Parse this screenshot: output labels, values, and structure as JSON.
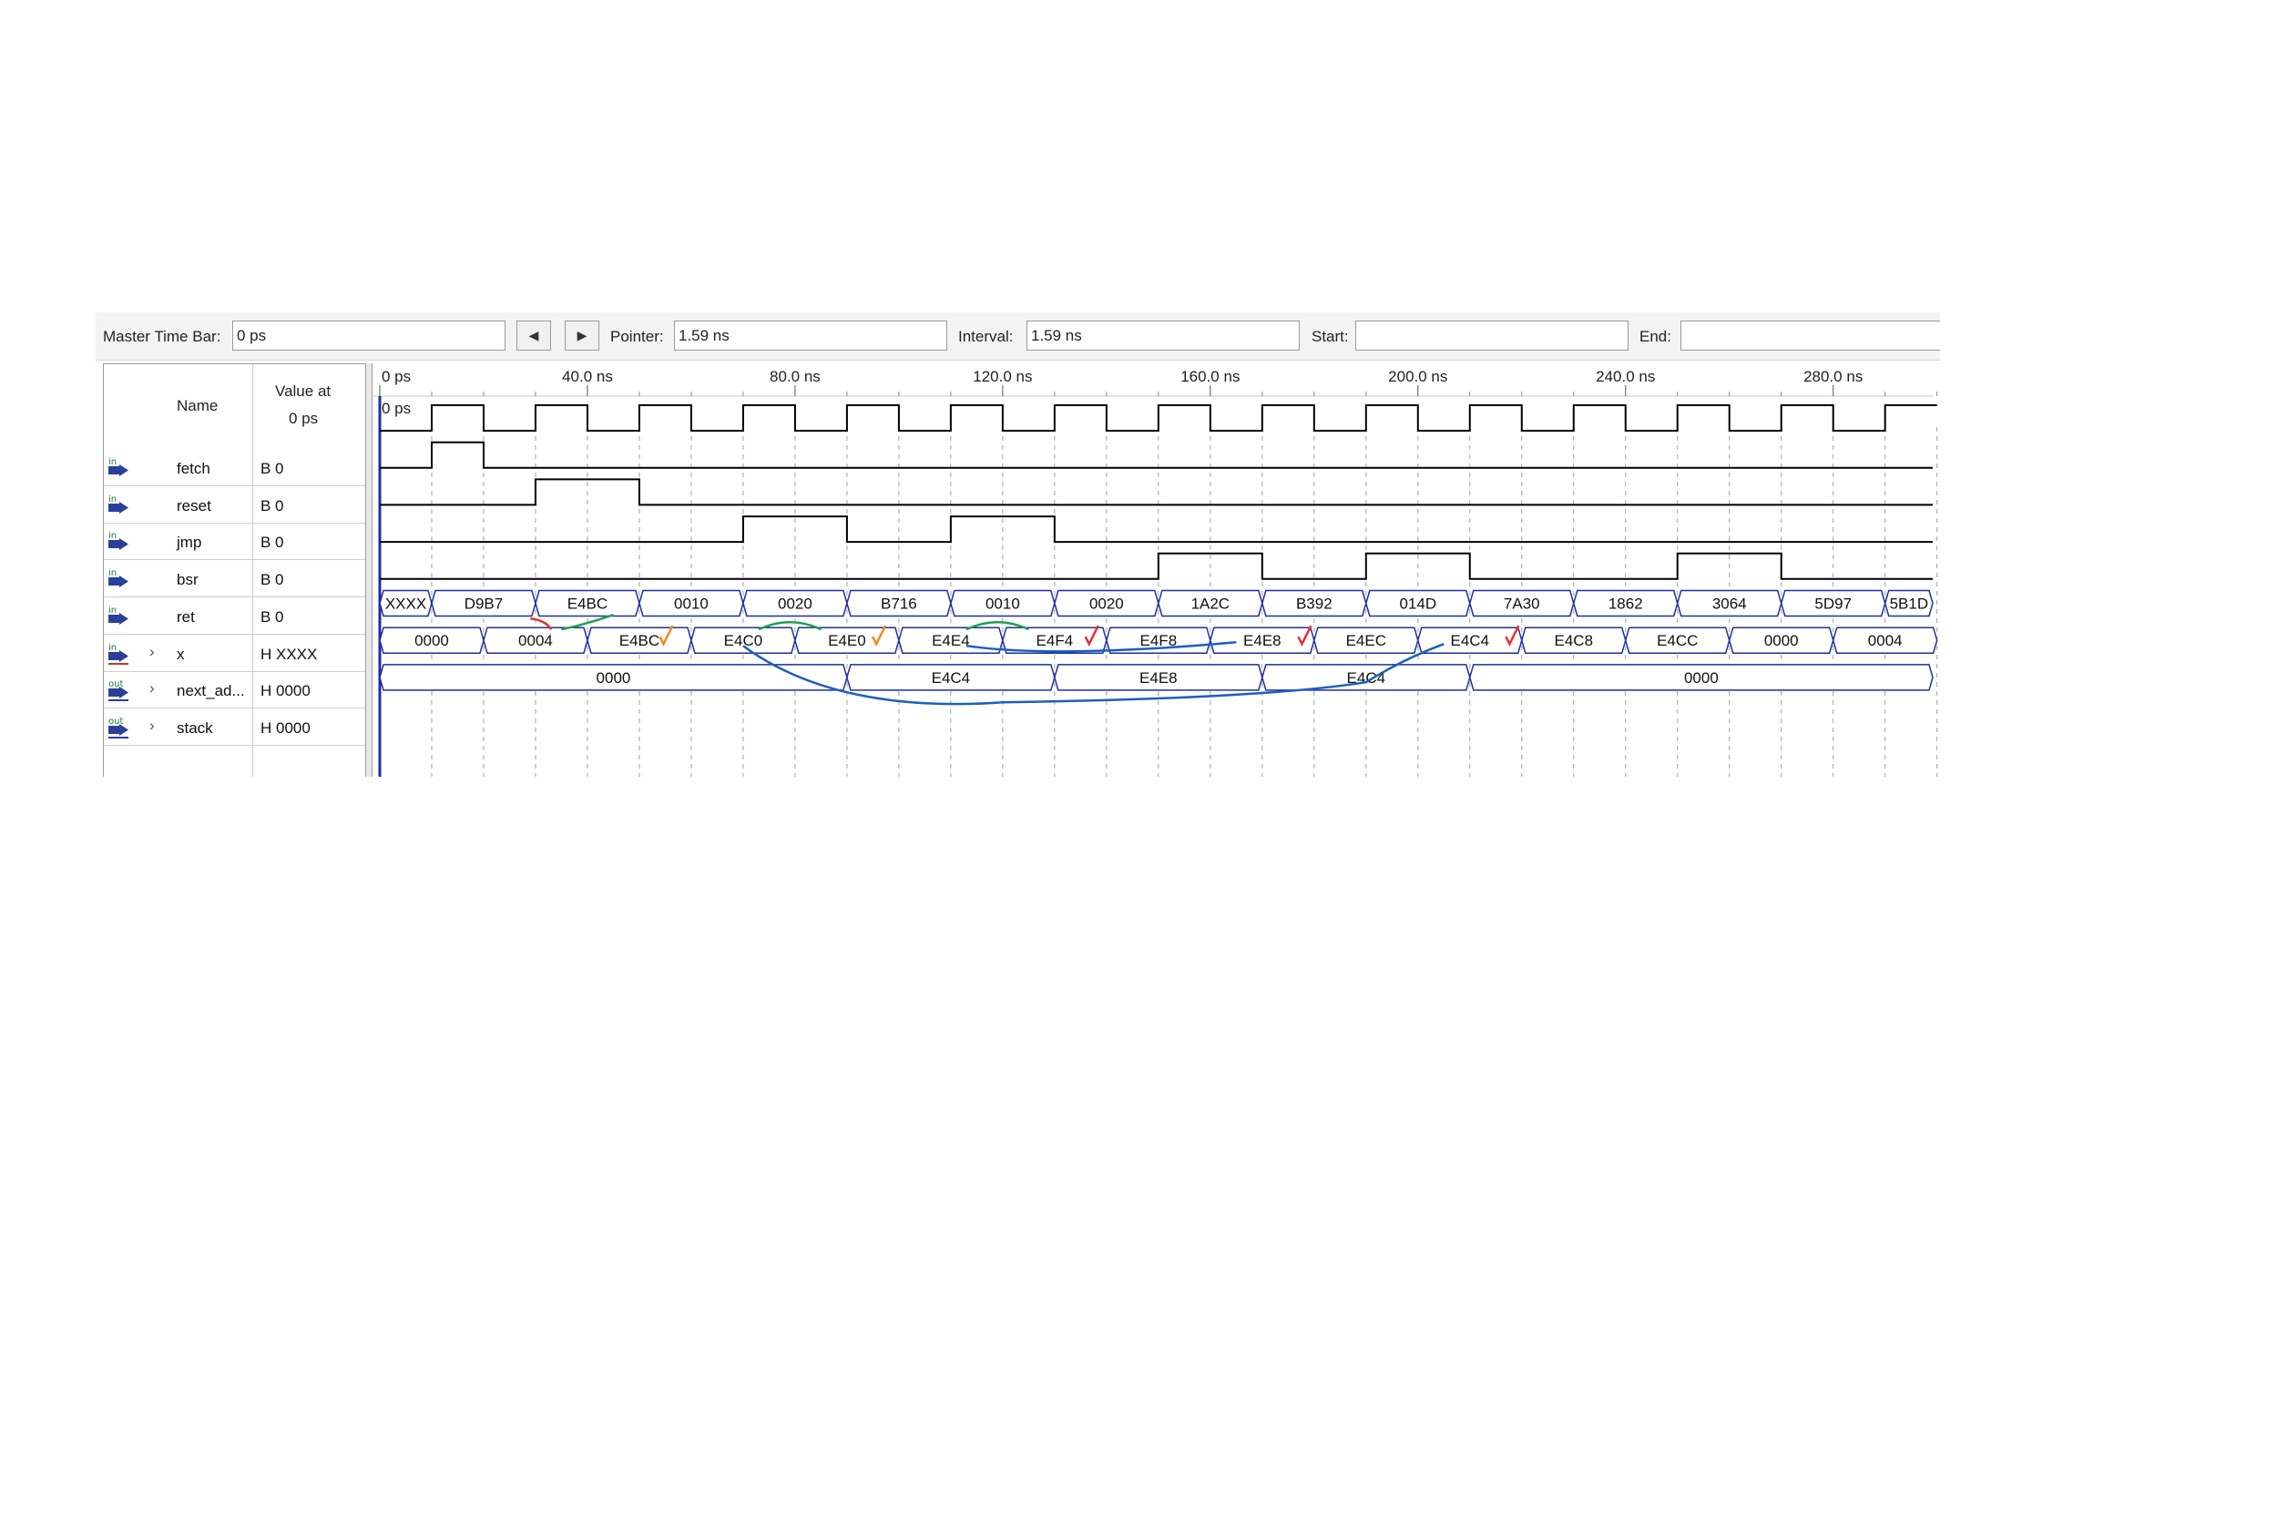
{
  "toolbar": {
    "master_time_bar_label": "Master Time Bar:",
    "master_time_bar_value": "0 ps",
    "pointer_label": "Pointer:",
    "pointer_value": "1.59 ns",
    "interval_label": "Interval:",
    "interval_value": "1.59 ns",
    "start_label": "Start:",
    "start_value": "",
    "end_label": "End:",
    "end_value": ""
  },
  "name_pane": {
    "name_header": "Name",
    "value_header_line1": "Value at",
    "value_header_line2": "0 ps"
  },
  "signals": [
    {
      "name": "fetch",
      "value": "B 0",
      "direction": "in",
      "type": "bit",
      "expandable": false
    },
    {
      "name": "reset",
      "value": "B 0",
      "direction": "in",
      "type": "bit",
      "expandable": false
    },
    {
      "name": "jmp",
      "value": "B 0",
      "direction": "in",
      "type": "bit",
      "expandable": false
    },
    {
      "name": "bsr",
      "value": "B 0",
      "direction": "in",
      "type": "bit",
      "expandable": false
    },
    {
      "name": "ret",
      "value": "B 0",
      "direction": "in",
      "type": "bit",
      "expandable": false
    },
    {
      "name": "x",
      "value": "H XXXX",
      "direction": "in",
      "type": "bus",
      "expandable": true
    },
    {
      "name": "next_ad...",
      "value": "H 0000",
      "direction": "out",
      "type": "bus",
      "expandable": true
    },
    {
      "name": "stack",
      "value": "H 0000",
      "direction": "out",
      "type": "bus",
      "expandable": true
    }
  ],
  "waveform": {
    "time_ticks": [
      "0 ps",
      "40.0 ns",
      "80.0 ns",
      "120.0 ns",
      "160.0 ns",
      "200.0 ns",
      "240.0 ns",
      "280.0 ns"
    ],
    "cursor_label": "0 ps",
    "time_unit_ns": 10,
    "time_range_ns": [
      0,
      300
    ],
    "fetch_period_ns": 20,
    "pulses_ns": {
      "reset": [
        [
          10,
          20
        ]
      ],
      "jmp": [
        [
          30,
          50
        ]
      ],
      "bsr": [
        [
          70,
          90
        ],
        [
          110,
          130
        ]
      ],
      "ret": [
        [
          150,
          170
        ],
        [
          190,
          210
        ],
        [
          250,
          270
        ]
      ]
    },
    "buses": {
      "x": {
        "starts_ns": [
          0,
          10,
          30,
          50,
          70,
          90,
          110,
          130,
          150,
          170,
          190,
          210,
          230,
          250,
          270,
          290
        ],
        "values": [
          "XXXX",
          "D9B7",
          "E4BC",
          "0010",
          "0020",
          "B716",
          "0010",
          "0020",
          "1A2C",
          "B392",
          "014D",
          "7A30",
          "1862",
          "3064",
          "5D97",
          "5B1D"
        ]
      },
      "next_ad": {
        "starts_ns": [
          0,
          20,
          40,
          60,
          80,
          100,
          120,
          140,
          160,
          180,
          200,
          220,
          240,
          260,
          280,
          300
        ],
        "values": [
          "0000",
          "0004",
          "E4BC",
          "E4C0",
          "E4E0",
          "E4E4",
          "E4F4",
          "E4F8",
          "E4E8",
          "E4EC",
          "E4C4",
          "E4C8",
          "E4CC",
          "0000",
          "0004"
        ]
      },
      "stack": {
        "starts_ns": [
          0,
          90,
          130,
          170,
          210
        ],
        "values": [
          "0000",
          "E4C4",
          "E4E8",
          "E4C4",
          "0000"
        ]
      }
    },
    "colors": {
      "grid_dash": "#a0a0a0",
      "bit_trace": "#000000",
      "bus_trace": "#1f2f9f",
      "cursor": "#1a2fa0",
      "annotation_red": "#e8312a",
      "annotation_orange": "#f08a1c",
      "annotation_green": "#20a050",
      "annotation_blue": "#1a5fbf"
    }
  }
}
